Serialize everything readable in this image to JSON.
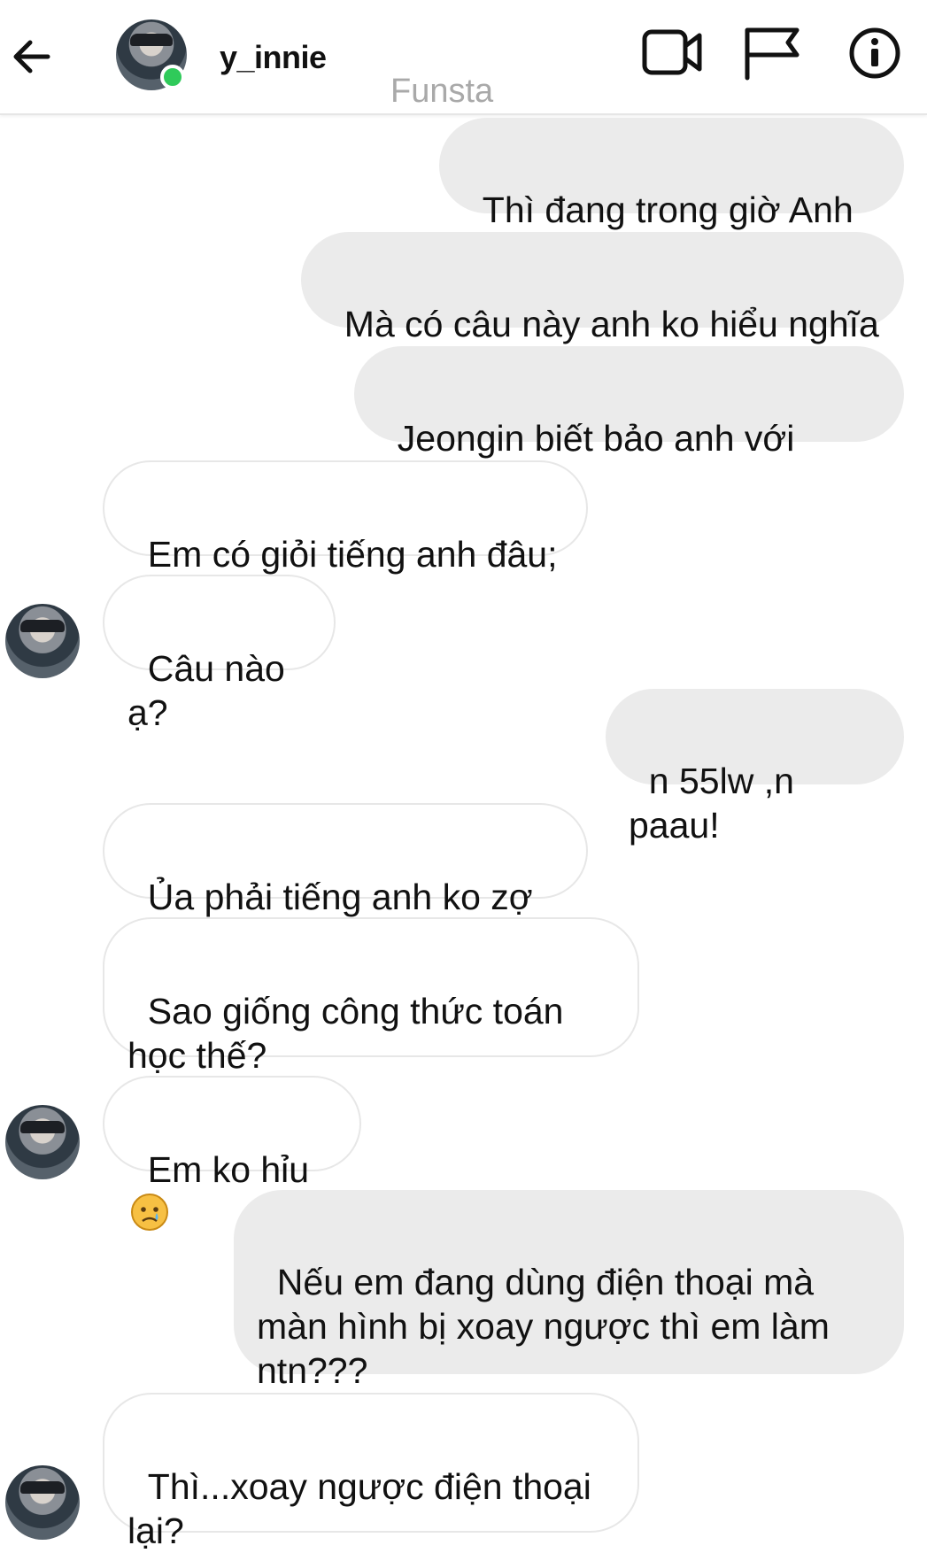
{
  "header": {
    "username": "y_innie",
    "subtitle": "Funsta"
  },
  "messages": [
    {
      "text": "Thì đang trong giờ Anh á",
      "emoji": ""
    },
    {
      "text": "Mà có câu này anh ko hiểu nghĩa",
      "emoji": ""
    },
    {
      "text": "Jeongin biết bảo anh với",
      "emoji": "👉👉"
    },
    {
      "text": "Em có giỏi tiếng anh đâu;(",
      "emoji": ""
    },
    {
      "text": "Câu nào ạ?",
      "emoji": ""
    },
    {
      "text": "n 55lw ,n paau!",
      "emoji": ""
    },
    {
      "text": "Ủa phải tiếng anh ko zợ",
      "emoji": "🤔"
    },
    {
      "text": "Sao giống công thức toán\nhọc thế?",
      "emoji": ""
    },
    {
      "text": "Em ko hỉu",
      "emoji": "😢"
    },
    {
      "text": "Nếu em đang dùng điện thoại mà\nmàn hình bị xoay ngược thì em làm\nntn???",
      "emoji": ""
    },
    {
      "text": "Thì...xoay ngược điện thoại\nlại?",
      "emoji": ""
    }
  ],
  "icons": {
    "back": "arrow-left-icon",
    "video": "video-camera-icon",
    "report": "flag-icon",
    "info": "info-icon",
    "pointing": "pointing-right-emoji",
    "thinking": "thinking-face-emoji",
    "sad": "sad-face-emoji"
  },
  "colors": {
    "outgoing_bubble": "#ebebeb",
    "incoming_border": "#e7e7e7",
    "online": "#2fca5a",
    "subtitle": "#a9a9a9"
  }
}
